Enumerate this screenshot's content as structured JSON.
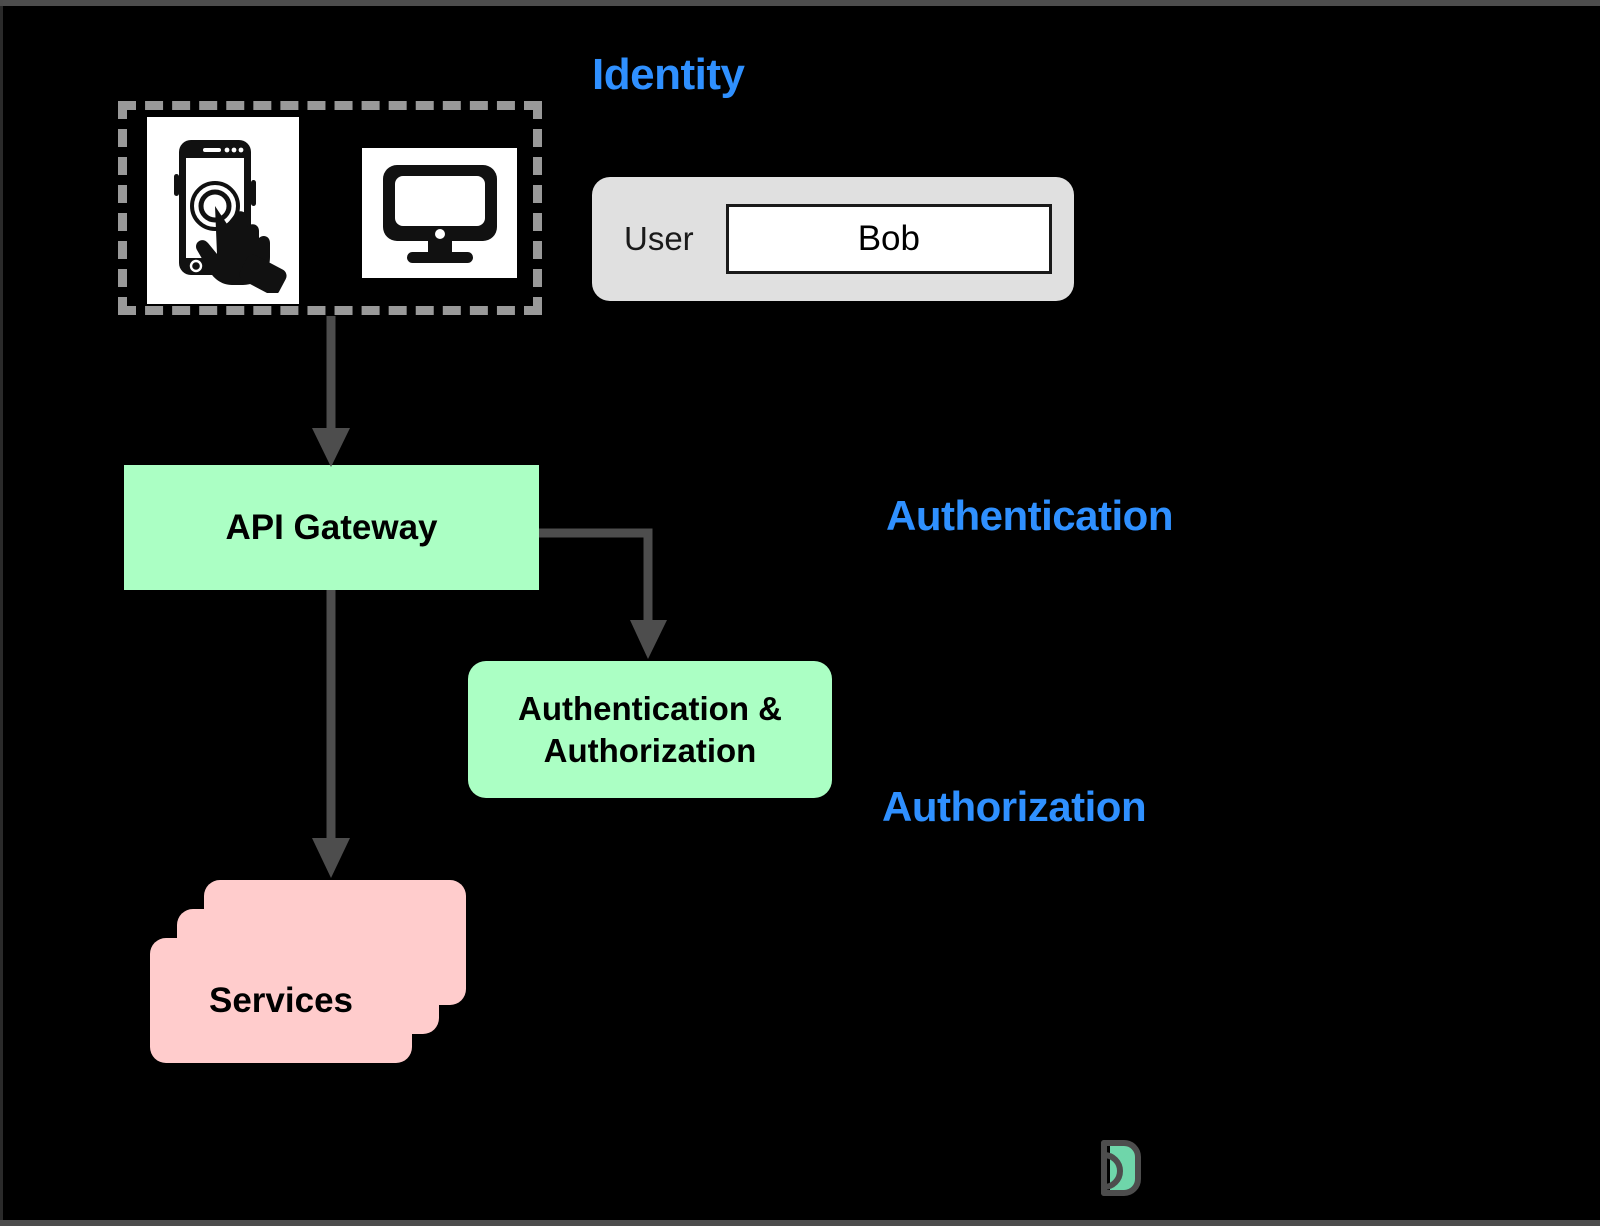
{
  "diagram": {
    "background_color": "#000000",
    "accent_color": "#2f90ff",
    "process_color": "#abffc4",
    "service_color": "#ffcccc",
    "connector_color": "#4d4d4d",
    "section_labels": {
      "identity": "Identity",
      "authentication": "Authentication",
      "authorization": "Authorization"
    },
    "client_group": {
      "devices": [
        {
          "icon": "mobile-touch-icon",
          "name": "mobile-device"
        },
        {
          "icon": "desktop-monitor-icon",
          "name": "desktop-device"
        }
      ]
    },
    "user_form": {
      "label": "User",
      "value": "Bob",
      "placeholder": "Bob"
    },
    "nodes": [
      {
        "id": "api-gateway",
        "label": "API Gateway",
        "shape": "rectangle",
        "fill": "#abffc4"
      },
      {
        "id": "auth",
        "label": "Authentication & Authorization",
        "line1": "Authentication &",
        "line2": "Authorization",
        "shape": "rounded-rectangle",
        "fill": "#abffc4"
      },
      {
        "id": "services",
        "label": "Services",
        "shape": "stacked-rounded-rectangle",
        "fill": "#ffcccc",
        "stack_count": 3
      }
    ],
    "edges": [
      {
        "from": "client-group",
        "to": "api-gateway",
        "style": "straight-down-arrow"
      },
      {
        "from": "api-gateway",
        "to": "auth",
        "style": "elbow-right-down-arrow"
      },
      {
        "from": "api-gateway",
        "to": "services",
        "style": "straight-down-arrow"
      }
    ],
    "brand_mark": {
      "name": "brand-logo-icon",
      "outline_color": "#4d4d4d",
      "fill_color": "#6fd6aa"
    }
  }
}
